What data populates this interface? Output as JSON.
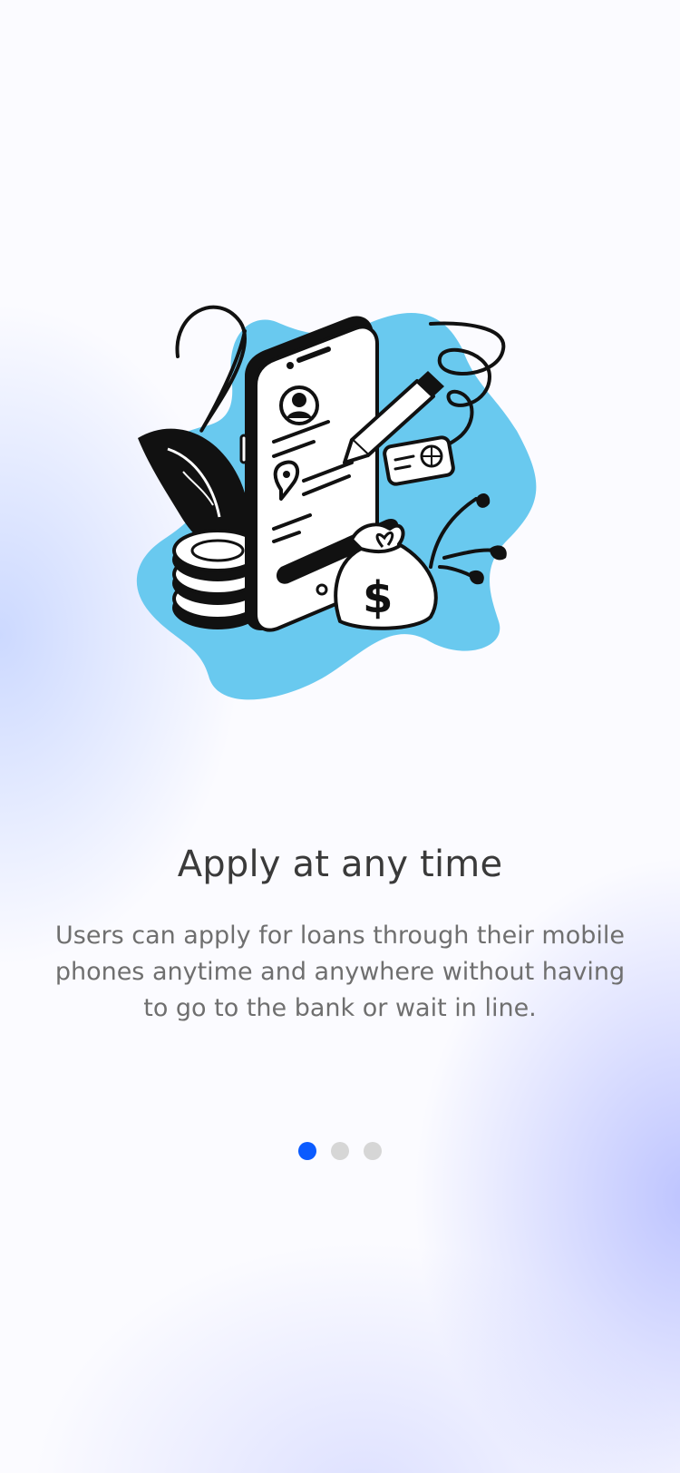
{
  "onboarding": {
    "title": "Apply at any time",
    "description": "Users can apply for loans through their mobile phones anytime and anywhere without having to go to the bank or wait in line.",
    "pagination": {
      "total": 3,
      "active_index": 0
    },
    "illustration": {
      "icon": "loan-application-illustration",
      "blob_color": "#69c9ef",
      "accent_color": "#0b5bff"
    }
  }
}
